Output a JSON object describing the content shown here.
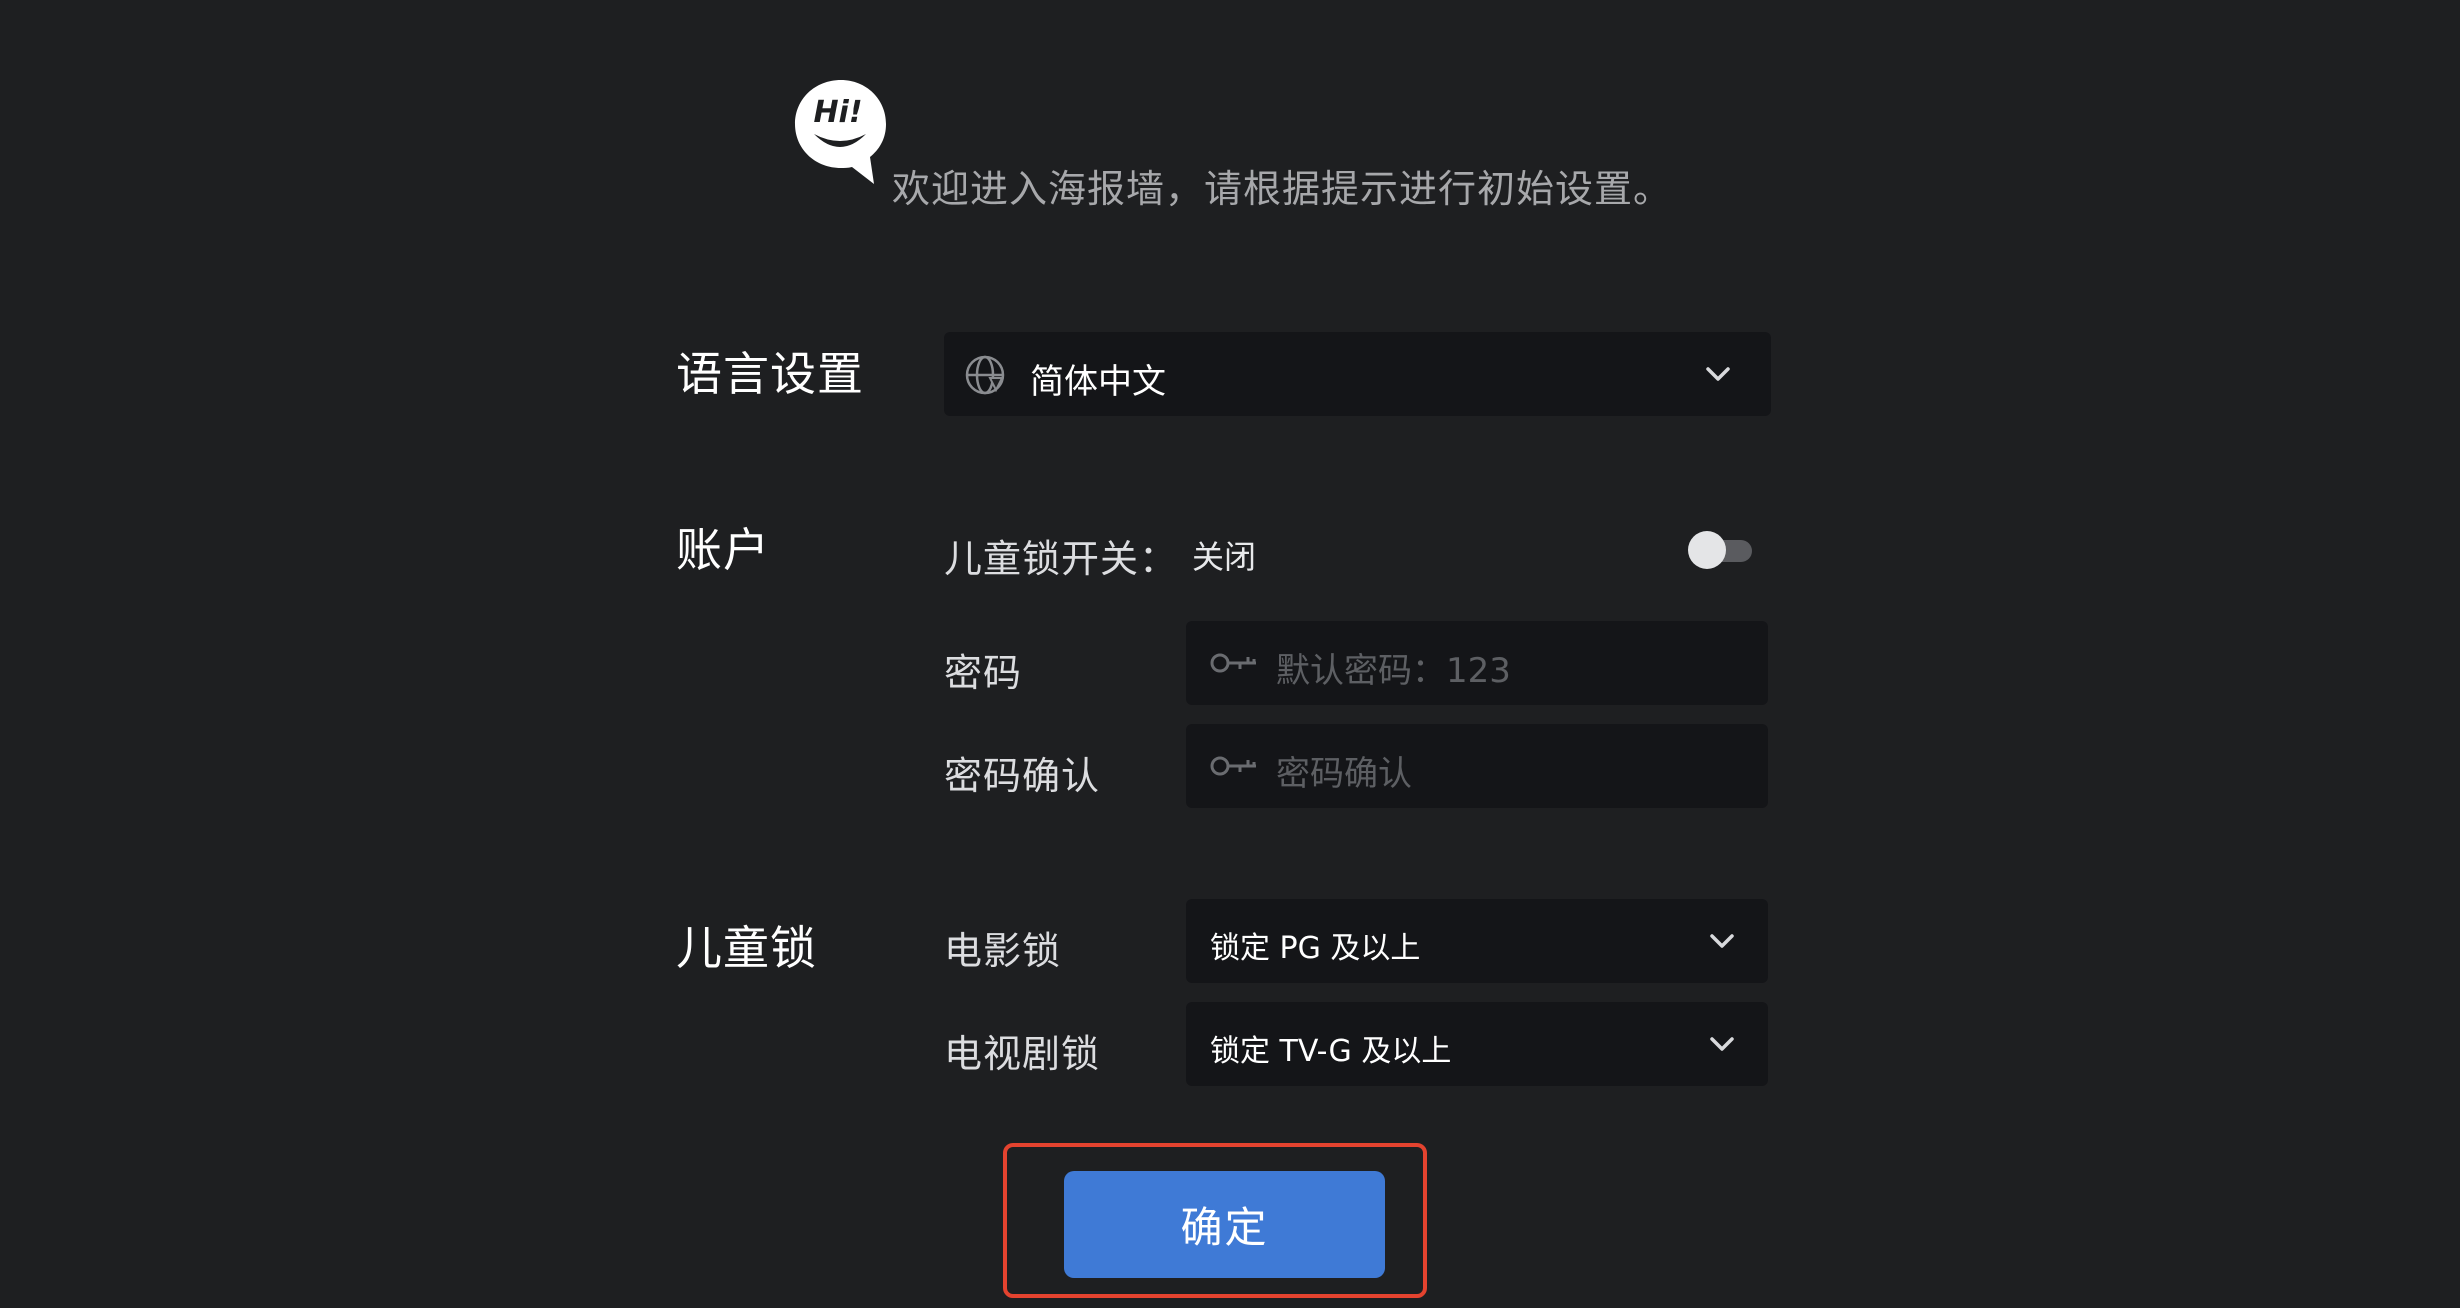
{
  "logo": {
    "text": "Hi!",
    "icon": "hi-chat-bubble-icon"
  },
  "welcome": "欢迎进入海报墙，请根据提示进行初始设置。",
  "language": {
    "section_title": "语言设置",
    "value": "简体中文",
    "icon": "globe-icon"
  },
  "account": {
    "section_title": "账户",
    "child_lock_label": "儿童锁开关：",
    "child_lock_state": "关闭",
    "child_lock_enabled": false,
    "password_label": "密码",
    "password_placeholder": "默认密码：123",
    "confirm_label": "密码确认",
    "confirm_placeholder": "密码确认"
  },
  "child_lock": {
    "section_title": "儿童锁",
    "movie_label": "电影锁",
    "movie_value": "锁定 PG 及以上",
    "tv_label": "电视剧锁",
    "tv_value": "锁定 TV-G 及以上"
  },
  "confirm_button": "确定",
  "colors": {
    "background": "#1e1f21",
    "field": "#141518",
    "accent": "#3f7ad6",
    "highlight": "#e4432f"
  }
}
